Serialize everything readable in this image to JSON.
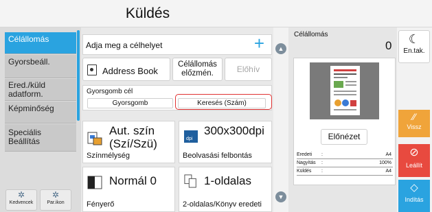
{
  "header": {
    "title": "Küldés"
  },
  "sidebar": {
    "items": [
      {
        "label": "Célállomás"
      },
      {
        "label": "Gyorsbeáll."
      },
      {
        "label": "Ered./küld adatform."
      },
      {
        "label": "Képminőség"
      },
      {
        "label": "Speciális Beállítás"
      }
    ],
    "bottom": [
      {
        "label": "Kedvencek",
        "icon": "gear-icon"
      },
      {
        "label": "Par.ikon",
        "icon": "gear-icon"
      }
    ]
  },
  "destination": {
    "label": "Adja meg a célhelyet",
    "add_icon": "+"
  },
  "toolbar": {
    "address_book": "Address Book",
    "history": "Célállomás előzmén.",
    "recall": "Előhív"
  },
  "quick": {
    "title": "Gyorsgomb cél",
    "btn1": "Gyorsgomb",
    "btn2": "Keresés (Szám)"
  },
  "tiles": [
    {
      "big": "Aut. szín (Szí/Szü)",
      "small": "Színmélység"
    },
    {
      "big": "300x300dpi",
      "small": "Beolvasási felbontás",
      "icon_text": "dpi"
    },
    {
      "big": "Normál 0",
      "small": "Fényerő"
    },
    {
      "big": "1-oldalas",
      "small": "2-oldalas/Könyv eredeti"
    }
  ],
  "preview": {
    "title": "Célállomás",
    "count": "0",
    "button": "Előnézet",
    "rows": [
      {
        "k": "Eredeti",
        "c": ":",
        "v": "A4"
      },
      {
        "k": "Nagyítás",
        "c": ":",
        "v": "100%"
      },
      {
        "k": "Küldés",
        "c": ":",
        "v": "A4"
      }
    ]
  },
  "actions": {
    "reset": "En.tak.",
    "back": "Vissz",
    "stop": "Leállít",
    "start": "Indítás"
  },
  "colors": {
    "accent": "#2aa3e0",
    "stop": "#e84a3f",
    "back": "#f0a43a",
    "highlight": "#e03030"
  }
}
